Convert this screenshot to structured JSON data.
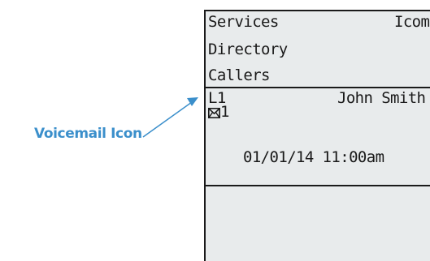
{
  "callout": {
    "label": "Voicemail Icon",
    "color": "#3b8fcb"
  },
  "screen": {
    "menu": {
      "services": "Services",
      "icom": "Icom",
      "directory": "Directory",
      "callers": "Callers"
    },
    "line": {
      "label": "L1",
      "name": "John Smith",
      "voicemail_icon": "envelope-icon",
      "voicemail_count": "1",
      "datetime": "01/01/14 11:00am"
    }
  }
}
